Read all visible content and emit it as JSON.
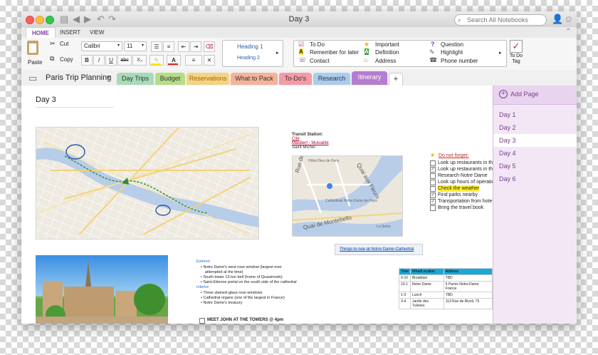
{
  "window": {
    "title": "Day 3",
    "search_placeholder": "Search All Notebooks"
  },
  "ribbon_tabs": [
    "HOME",
    "INSERT",
    "VIEW"
  ],
  "ribbon": {
    "paste": "Paste",
    "cut": "Cut",
    "copy": "Copy",
    "font_name": "Calibri",
    "font_size": "11",
    "bold": "B",
    "italic": "I",
    "underline": "U",
    "strike": "abc",
    "subscript": "X₂",
    "styles": [
      "Heading 1",
      "Heading 2"
    ],
    "tags_col1": [
      "To Do",
      "Remember for later",
      "Contact"
    ],
    "tags_col2": [
      "Important",
      "Definition",
      "Address"
    ],
    "tags_col3": [
      "Question",
      "Highlight",
      "Phone number"
    ],
    "todo_tag_label": "To Do Tag"
  },
  "notebook": {
    "name": "Paris Trip Planning",
    "sections": [
      {
        "label": "Day Trips",
        "color": "#a7dbb8"
      },
      {
        "label": "Budget",
        "color": "#b6dc86"
      },
      {
        "label": "Reservations",
        "color": "#f5d386"
      },
      {
        "label": "What to Pack",
        "color": "#f5b39a"
      },
      {
        "label": "To-Do's",
        "color": "#f59aa6"
      },
      {
        "label": "Research",
        "color": "#a9cdee"
      },
      {
        "label": "Itinerary",
        "color": "#b67ccf"
      }
    ],
    "add_section": "+"
  },
  "page": {
    "title": "Day 3",
    "transit": [
      "Transit Station:",
      "Cité",
      "Maubert - Mutualité",
      "Saint Michel"
    ],
    "map_labels": {
      "street1": "Rue de la Cité",
      "street2": "Quai aux Fleurs",
      "street3": "Quai de Montebello",
      "place1": "Hôtel-Dieu de Paris",
      "place2": "Cathédrale Notre-Dame de Paris",
      "place3": "La Seine"
    },
    "todo_header": "Do not forget:",
    "todos": [
      {
        "text": "Look up restaurants in the",
        "checked": false
      },
      {
        "text": "Look up restaurants in the",
        "checked": true
      },
      {
        "text": "Research Notre Dame",
        "checked": false
      },
      {
        "text": "Look up hours of operatio",
        "checked": false
      },
      {
        "text": "Check the weather",
        "checked": false,
        "highlight": true
      },
      {
        "text": "Find parks nearby",
        "checked": true
      },
      {
        "text": "Transportation from hote",
        "checked": true
      },
      {
        "text": "Bring the travel book",
        "checked": false
      }
    ],
    "link_caption": "Things to see at Notre Dame Cathedral",
    "exterior_header": "Exterior:",
    "exterior": [
      "Notre Dame's west rose window (largest ever",
      "attempted at the time)",
      "South tower 13-ton bell (home of Quasimodo)",
      "Saint-Etienne portal on the south side of the cathedral"
    ],
    "interior_header": "Interior:",
    "interior": [
      "Three stained-glass rose windows",
      "Cathedral organs (one of the largest in France)",
      "Notre Dame's treasury"
    ],
    "meet_note": "MEET JOHN AT THE TOWERS @ 4pm",
    "schedule": {
      "headers": [
        "Time",
        "What/Location",
        "Address"
      ],
      "rows": [
        [
          "9-10",
          "Breakfast",
          "TBD"
        ],
        [
          "10-1",
          "Notre Dame",
          "6 Parvis Notre-Dame France"
        ],
        [
          "1-3",
          "Lunch",
          "TBD"
        ],
        [
          "3-4",
          "Jardin des Tuleries",
          "113 Rue de Rivoli, 75"
        ]
      ]
    }
  },
  "pages_pane": {
    "add_page": "Add Page",
    "pages": [
      "Day 1",
      "Day 2",
      "Day 3",
      "Day 4",
      "Day 5",
      "Day 6"
    ],
    "active_index": 2
  }
}
